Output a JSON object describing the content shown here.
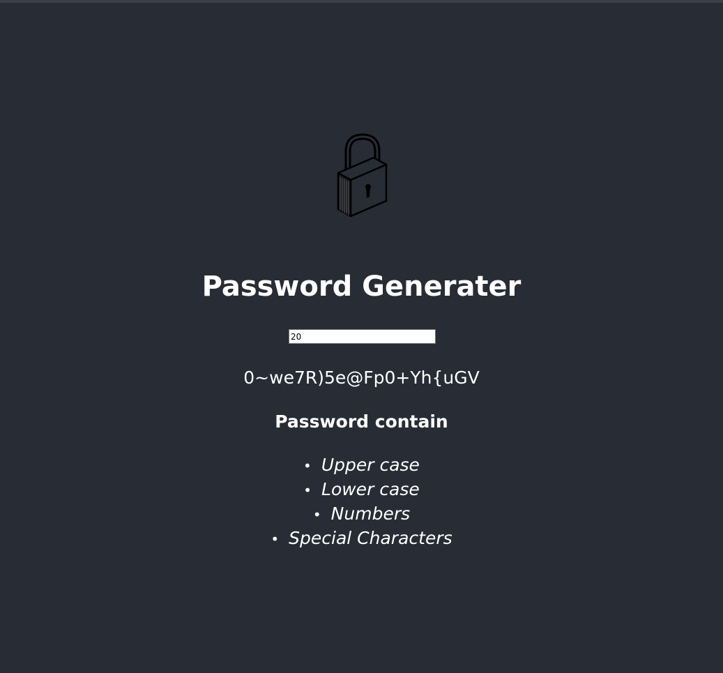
{
  "header": {
    "logo_icon": "padlock-icon",
    "title": "Password Generater"
  },
  "generator": {
    "length_value": "20",
    "password": "0~we7R)5e@Fp0+Yh{uGV"
  },
  "requirements": {
    "heading": "Password contain",
    "bullet": "•",
    "items": [
      "Upper case",
      "Lower case",
      "Numbers",
      "Special Characters"
    ]
  },
  "colors": {
    "background": "#282c34",
    "text": "#ffffff"
  }
}
